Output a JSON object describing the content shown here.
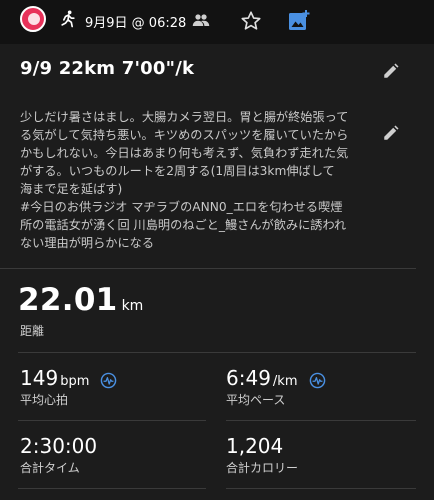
{
  "header": {
    "date_time": "9月9日 @ 06:28"
  },
  "activity": {
    "title": "9/9 22km 7'00\"/k",
    "description": "少しだけ暑さはまし。大腸カメラ翌日。胃と腸が終始張って\nる気がして気持ち悪い。キツめのスパッツを履いていたから\nかもしれない。今日はあまり何も考えず、気負わず走れた気\nがする。いつものルートを2周する(1周目は3km伸ばして\n海まで足を延ばす)\n#今日のお供ラジオ マヂラブのANN0_エロを匂わせる喫煙\n所の電話女が湧く回 川島明のねごと_鰻さんが飲みに誘われ\nない理由が明らかになる"
  },
  "metrics": {
    "distance": {
      "value": "22.01",
      "unit": "km",
      "label": "距離"
    },
    "heart_rate": {
      "value": "149",
      "unit": "bpm",
      "label": "平均心拍"
    },
    "pace": {
      "value": "6:49",
      "unit": "/km",
      "label": "平均ペース"
    },
    "time": {
      "value": "2:30:00",
      "label": "合計タイム"
    },
    "calories": {
      "value": "1,204",
      "label": "合計カロリー"
    }
  },
  "colors": {
    "accent_blue": "#4a90e2",
    "avatar_pink": "#e8325a",
    "background": "#1c1c1c"
  },
  "icons": {
    "activity_type": "running-icon",
    "privacy": "people-icon",
    "favorite": "star-icon",
    "add_photo": "add-photo-icon",
    "edit": "pencil-icon",
    "detail": "heart-rate-icon"
  }
}
